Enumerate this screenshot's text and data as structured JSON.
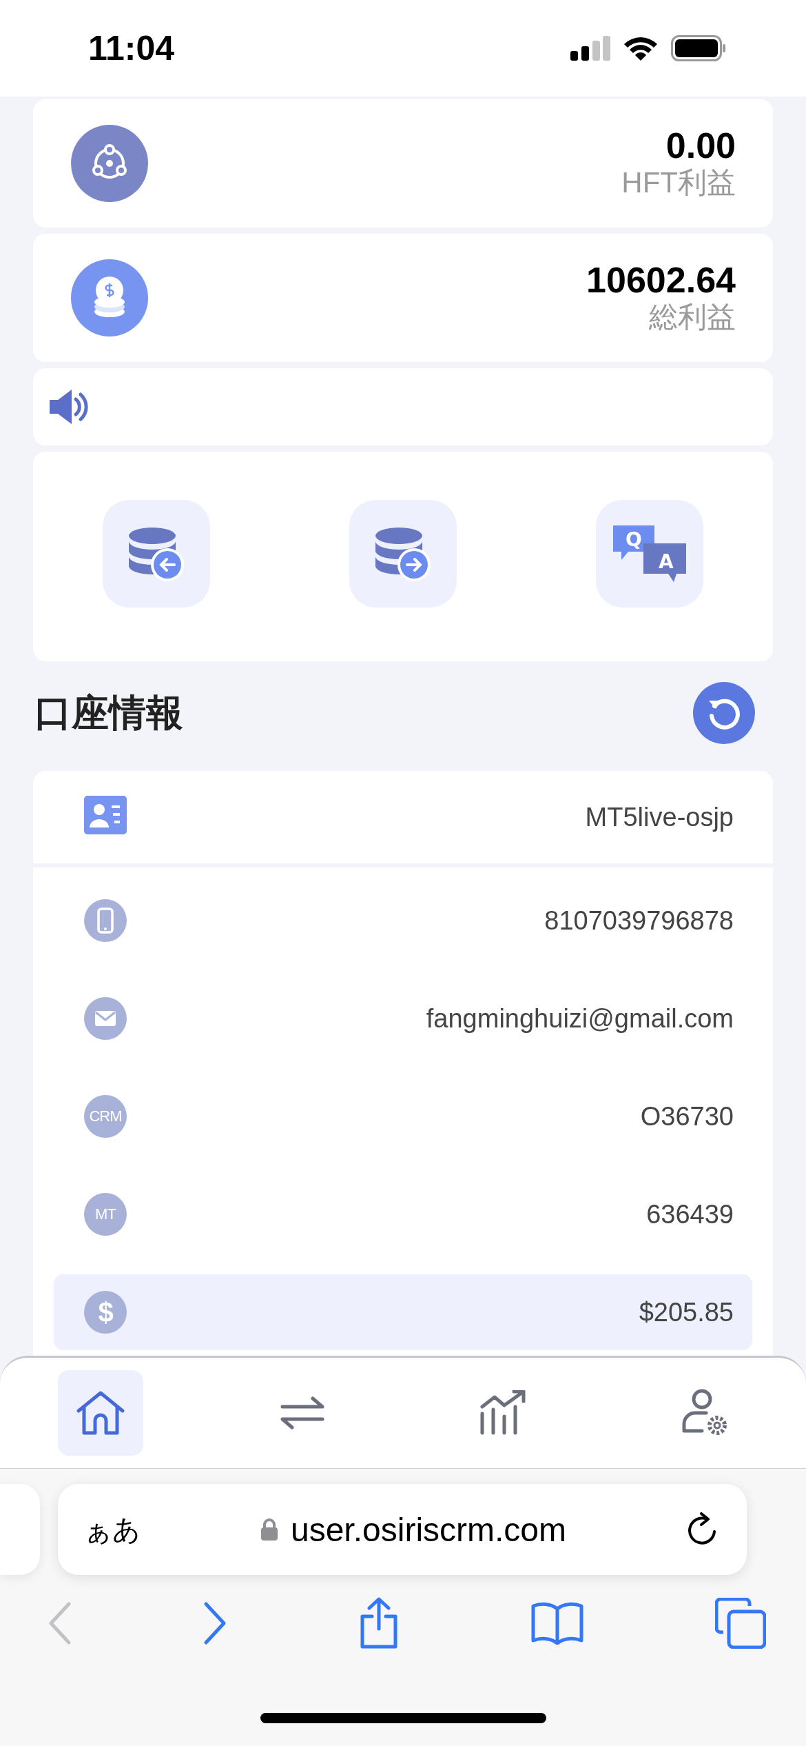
{
  "status_bar": {
    "time": "11:04"
  },
  "stats": [
    {
      "kind": "hft",
      "value": "0.00",
      "label": "HFT利益"
    },
    {
      "kind": "total",
      "value": "10602.64",
      "label": "総利益"
    }
  ],
  "actions": [
    {
      "kind": "deposit"
    },
    {
      "kind": "withdraw"
    },
    {
      "kind": "qa",
      "q": "Q",
      "a": "A"
    }
  ],
  "account": {
    "title": "口座情報",
    "rows": [
      {
        "kind": "card",
        "value": "MT5live-osjp",
        "selected": false
      },
      {
        "kind": "phone",
        "value": "8107039796878",
        "selected": false
      },
      {
        "kind": "mail",
        "value": "fangminghuizi@gmail.com",
        "selected": false
      },
      {
        "kind": "text",
        "badge": "CRM",
        "value": "O36730",
        "selected": false
      },
      {
        "kind": "text",
        "badge": "MT",
        "value": "636439",
        "selected": false
      },
      {
        "kind": "text",
        "badge": "$",
        "value": "$205.85",
        "selected": true
      }
    ]
  },
  "nav": [
    {
      "kind": "home",
      "selected": true
    },
    {
      "kind": "transfer",
      "selected": false
    },
    {
      "kind": "chart",
      "selected": false
    },
    {
      "kind": "profile",
      "selected": false
    }
  ],
  "browser": {
    "text_size": "ぁあ",
    "url": "user.osiriscrm.com",
    "back_disabled": true,
    "forward_disabled": false
  }
}
